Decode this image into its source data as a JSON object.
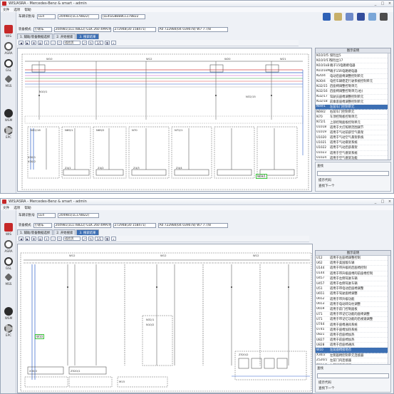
{
  "window": {
    "title": "WIS/ASRA - Mercedes-Benz & smart - admin",
    "controls": {
      "min": "_",
      "max": "□",
      "close": "×"
    }
  },
  "menu": [
    "文件",
    "选项",
    "帮助"
  ],
  "sidebar": [
    {
      "label": "WIS",
      "icon": "wis-book-icon",
      "color": "#c62828"
    },
    {
      "label": "ASRA",
      "icon": "asra-clock-icon",
      "color": "#5a5a5a"
    },
    {
      "label": "GSL",
      "icon": "gsl-search-icon",
      "color": "#3a3a3a"
    },
    {
      "label": "MSS",
      "icon": "mss-wrench-icon",
      "color": "#4a4a4a"
    },
    {
      "label": "WSM",
      "icon": "wsm-play-icon",
      "color": "#2b2b2b"
    },
    {
      "label": "EPC",
      "icon": "epc-gear-icon",
      "color": "#5a5a5a"
    }
  ],
  "vehicle": {
    "label": "车辆识别号",
    "vin_prefix": "LE4",
    "model": "204981(1L178822)",
    "engine_code": "[LE4GG8BB8CL178822"
  },
  "filters": {
    "mode_label": "装备模式",
    "mode_value": "小轿车",
    "model": "204981(1L178822) GLK 260 4MATIC",
    "engine": "272948(30 158471)",
    "gearbox": "A0 722984(04 039078) W7 7.7/8"
  },
  "tabs": [
    "1. 辅助/装备数据选择",
    "2. 开始搜索",
    "3. 搜索结果"
  ],
  "toolbar": {
    "zoom": "适应页",
    "page_label": "1/1"
  },
  "side_panel": {
    "header": "图示说明",
    "search_label": "查找",
    "hint": "提示代码",
    "next": "查找下一个"
  },
  "window1": {
    "legend": [
      {
        "code": "N10/1f5",
        "text": "保险丝5"
      },
      {
        "code": "N10/1f17",
        "text": "保险丝17"
      },
      {
        "code": "N10/1kB",
        "text": "端子15电路继电器"
      },
      {
        "code": "N10/1kM",
        "text": "端子15R电路继电器"
      },
      {
        "code": "N20/4",
        "text": "电动后座椅调整控制单元"
      },
      {
        "code": "N30/4",
        "text": "电控车辆稳定行驶系统控制单元"
      },
      {
        "code": "N32/15",
        "text": "后座椅调整控制单元"
      },
      {
        "code": "N32/16",
        "text": "后座椅调整控制单元(右)"
      },
      {
        "code": "N32/17",
        "text": "驾驶员座椅调整控制单元"
      },
      {
        "code": "N32/18",
        "text": "前乘客座椅调整控制单元"
      },
      {
        "code": "N69/1",
        "text": "左前车门控制单元"
      },
      {
        "code": "N69/2",
        "text": "右前车门控制单元"
      },
      {
        "code": "N70",
        "text": "车顶控制板控制单元"
      },
      {
        "code": "N72/1",
        "text": "上部控制面板控制单元"
      },
      {
        "code": "U1018",
        "text": "适用于大灯照明范围调节"
      },
      {
        "code": "U1019",
        "text": "适用于气动前部空气悬架"
      },
      {
        "code": "U1020",
        "text": "适用于气动空气悬架系统"
      },
      {
        "code": "U1021",
        "text": "适用于气动悬架系统"
      },
      {
        "code": "U1022",
        "text": "适用于气动后部悬架"
      },
      {
        "code": "U1023",
        "text": "适用于空气悬架系统"
      },
      {
        "code": "U1024",
        "text": "适用于空气悬架功能"
      },
      {
        "code": "U1025",
        "text": "适用于车辆水平高度调节"
      },
      {
        "code": "U1026",
        "text": "适用于发动机273 DE"
      },
      {
        "code": "U1027",
        "text": "适用于发动机272 DE"
      },
      {
        "code": "U1028",
        "text": "适用于发动机271 DE"
      },
      {
        "code": "U1029",
        "text": "适用于大型发动机"
      }
    ],
    "selected_index": 10,
    "diagram_labels": [
      "W10",
      "W12",
      "W20",
      "W21",
      "W22",
      "W23",
      "N10/1",
      "N32/15",
      "N32/16",
      "N69/1",
      "N69/2",
      "N70",
      "N72/1",
      "f5",
      "f17",
      "kB",
      "kM",
      "X30/1",
      "X30/2",
      "X30/3",
      "X30/4",
      "Z4/1",
      "Z4/2",
      "Z4/3",
      "Z4/4",
      "W10/1",
      "W10/2"
    ],
    "highlight": "N69/1"
  },
  "window2": {
    "legend": [
      {
        "code": "U12",
        "text": "适用于左座椅调整控制"
      },
      {
        "code": "U62",
        "text": "适用于美国版车辆"
      },
      {
        "code": "U144",
        "text": "适用于带升级的后座椅控制"
      },
      {
        "code": "U144",
        "text": "适用于带升级座椅的前座椅控制"
      },
      {
        "code": "U457",
        "text": "适用于左侧驾驶车辆"
      },
      {
        "code": "U457",
        "text": "适用于右侧驾驶车辆"
      },
      {
        "code": "U51",
        "text": "适用于带电动后座椅调整"
      },
      {
        "code": "U651",
        "text": "适用于驾驶座椅调整"
      },
      {
        "code": "U652",
        "text": "适用于带升级功能"
      },
      {
        "code": "U653",
        "text": "适用于电动转向柱调整"
      },
      {
        "code": "U659",
        "text": "适用于前门控制面板"
      },
      {
        "code": "U71",
        "text": "适用于带记忆功能的座椅调整"
      },
      {
        "code": "U71",
        "text": "适用于带记忆功能的后视镜调整"
      },
      {
        "code": "U744",
        "text": "适用于座椅通风系统"
      },
      {
        "code": "U745",
        "text": "适用于座椅加热系统"
      },
      {
        "code": "U821",
        "text": "适用于后座椅加热"
      },
      {
        "code": "U827",
        "text": "适用于前座椅加热"
      },
      {
        "code": "U828",
        "text": "适用于后座椅通风"
      },
      {
        "code": "W10",
        "text": "左前座椅接地点"
      },
      {
        "code": "X30/2",
        "text": "左侧座椅控制单元连接器"
      },
      {
        "code": "Z520/1",
        "text": "左前门内连接器"
      },
      {
        "code": "Z520/2",
        "text": "左前门内连接器"
      },
      {
        "code": "Z520/3",
        "text": "右前门内连接器"
      }
    ],
    "selected_index": 18,
    "diagram_labels": [
      "W12",
      "W10",
      "N32/1",
      "N32/2",
      "N32/3",
      "N10/2",
      "A18",
      "A29",
      "M15",
      "X30/2",
      "Z520/1",
      "Z520/2",
      "B46",
      "S60"
    ],
    "highlight": "W10"
  }
}
